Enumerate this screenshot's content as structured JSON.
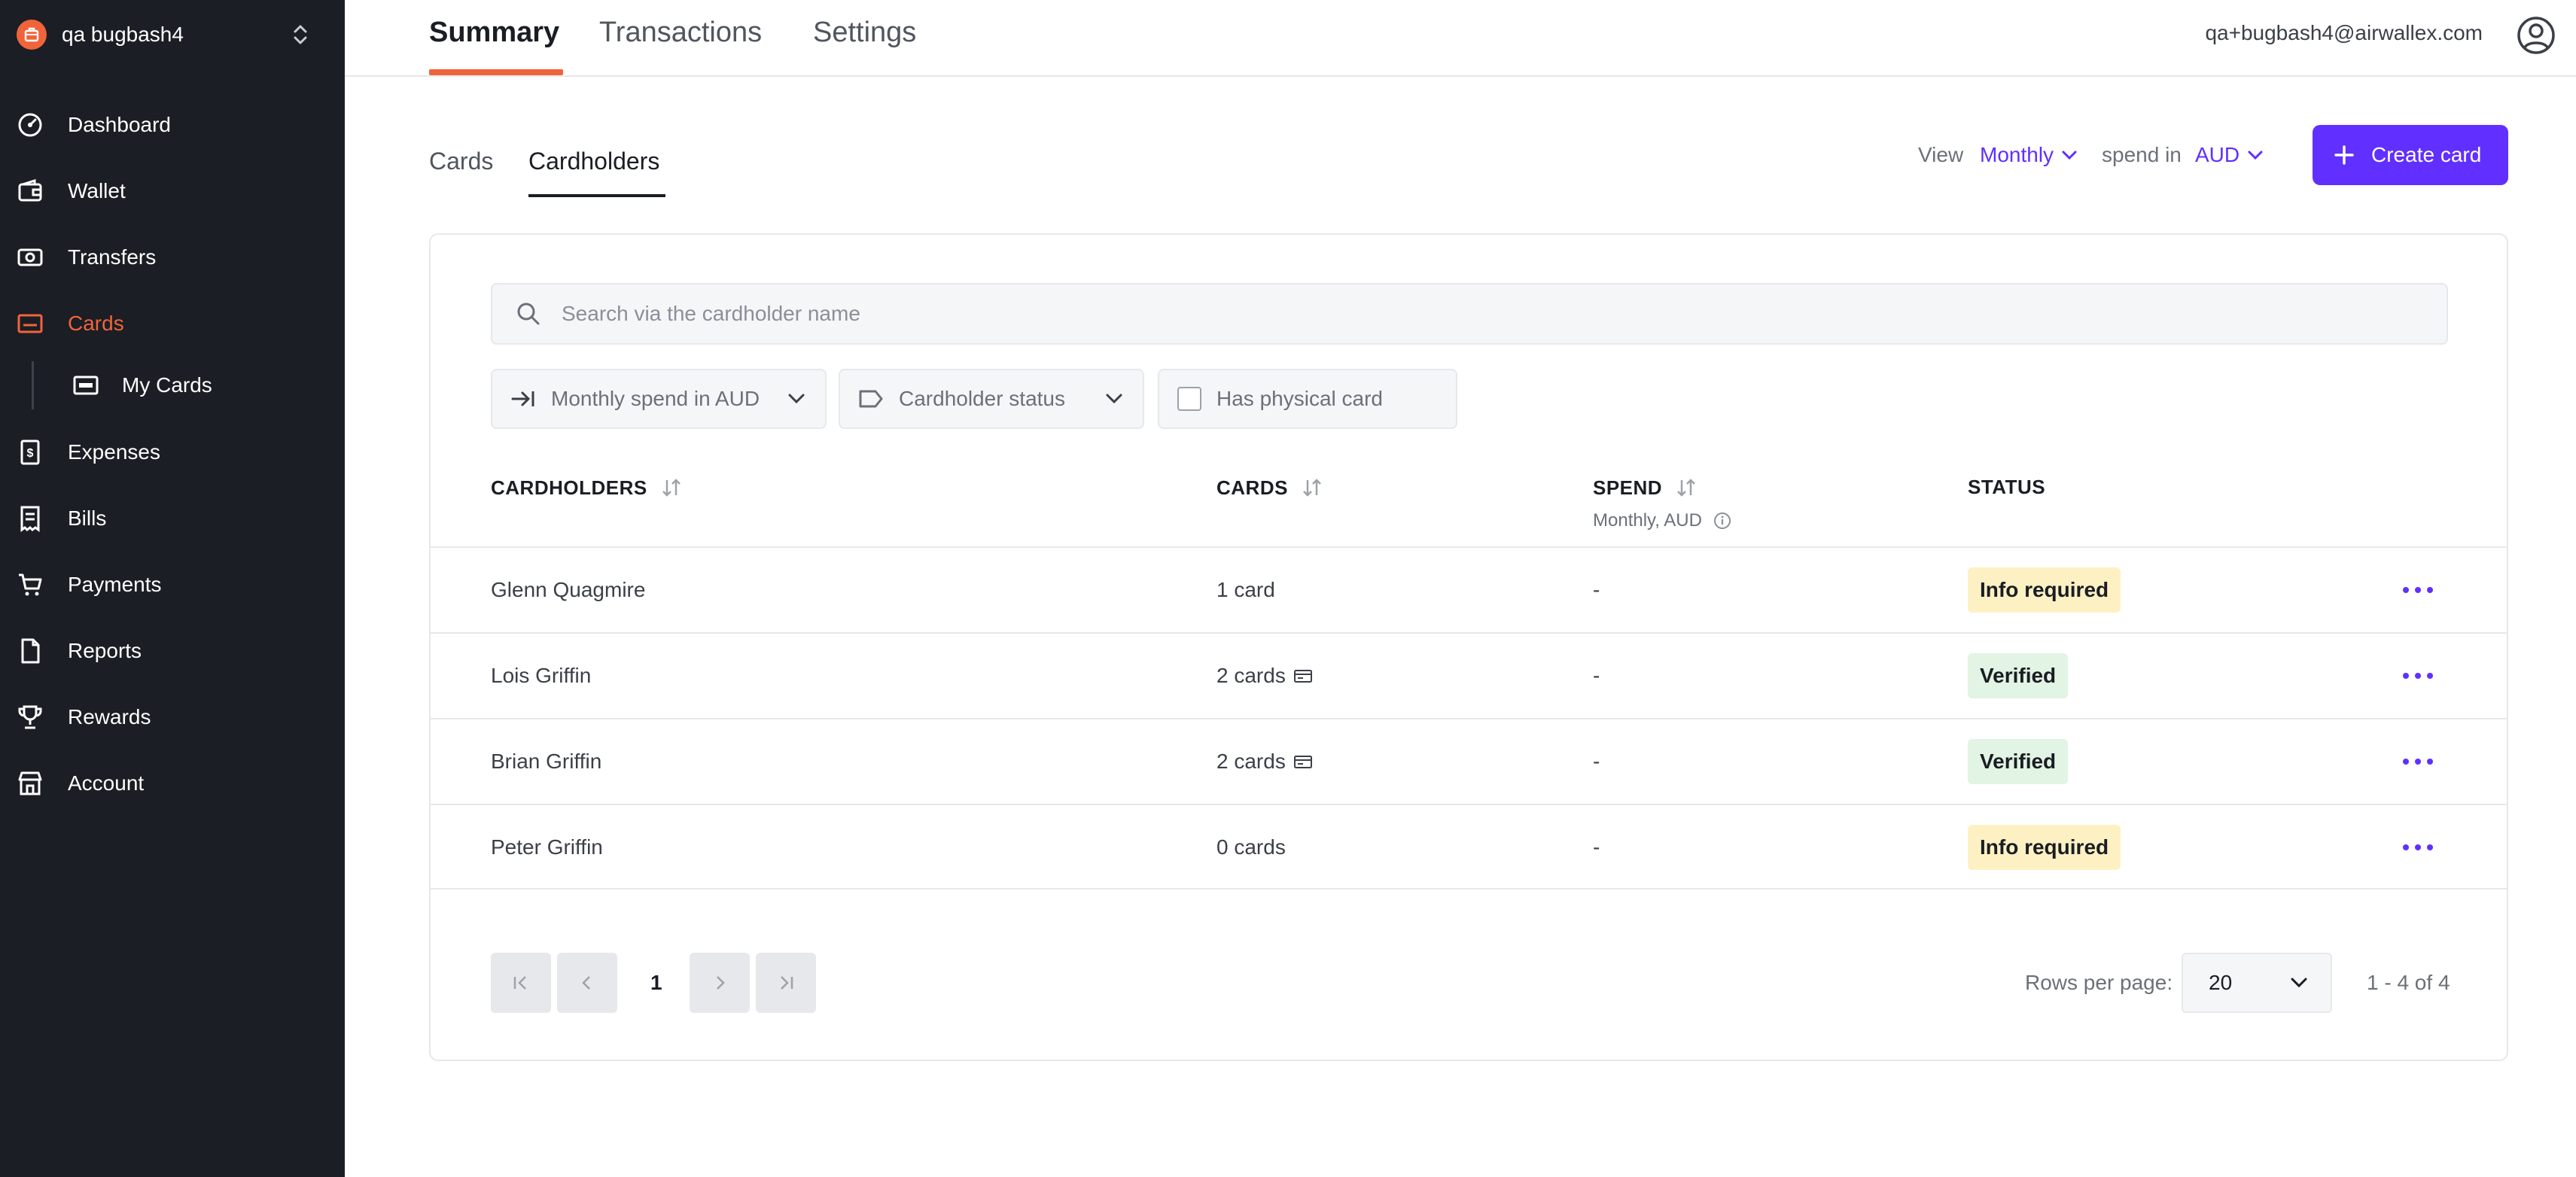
{
  "sidebar": {
    "org_name": "qa bugbash4",
    "items": [
      {
        "label": "Dashboard",
        "icon": "dashboard-icon"
      },
      {
        "label": "Wallet",
        "icon": "wallet-icon"
      },
      {
        "label": "Transfers",
        "icon": "transfers-icon"
      },
      {
        "label": "Cards",
        "icon": "card-icon",
        "active": true
      },
      {
        "label": "My Cards",
        "icon": "card-icon",
        "sub": true
      },
      {
        "label": "Expenses",
        "icon": "expenses-icon"
      },
      {
        "label": "Bills",
        "icon": "bills-icon"
      },
      {
        "label": "Payments",
        "icon": "cart-icon"
      },
      {
        "label": "Reports",
        "icon": "document-icon"
      },
      {
        "label": "Rewards",
        "icon": "trophy-icon"
      },
      {
        "label": "Account",
        "icon": "store-icon"
      }
    ]
  },
  "header": {
    "tabs": [
      {
        "label": "Summary",
        "active": true
      },
      {
        "label": "Transactions"
      },
      {
        "label": "Settings"
      }
    ],
    "user_email": "qa+bugbash4@airwallex.com"
  },
  "subtabs": [
    {
      "label": "Cards"
    },
    {
      "label": "Cardholders",
      "active": true
    }
  ],
  "view_controls": {
    "view_label": "View",
    "period": "Monthly",
    "spend_label": "spend in",
    "currency": "AUD",
    "create_button": "Create card"
  },
  "search": {
    "placeholder": "Search via the cardholder name",
    "value": ""
  },
  "filters": {
    "spend": "Monthly spend in AUD",
    "status": "Cardholder status",
    "physical": "Has physical card"
  },
  "table": {
    "columns": {
      "cardholders": "CARDHOLDERS",
      "cards": "CARDS",
      "spend": "SPEND",
      "spend_sub": "Monthly, AUD",
      "status": "STATUS"
    },
    "rows": [
      {
        "name": "Glenn Quagmire",
        "cards": "1 card",
        "card_icon": false,
        "spend": "-",
        "status": "Info required",
        "status_type": "warn"
      },
      {
        "name": "Lois Griffin",
        "cards": "2 cards",
        "card_icon": true,
        "spend": "-",
        "status": "Verified",
        "status_type": "ok"
      },
      {
        "name": "Brian Griffin",
        "cards": "2 cards",
        "card_icon": true,
        "spend": "-",
        "status": "Verified",
        "status_type": "ok"
      },
      {
        "name": "Peter Griffin",
        "cards": "0 cards",
        "card_icon": false,
        "spend": "-",
        "status": "Info required",
        "status_type": "warn"
      }
    ]
  },
  "pagination": {
    "current_page": "1",
    "rows_per_page_label": "Rows per page:",
    "rows_per_page": "20",
    "range": "1 - 4 of 4"
  },
  "colors": {
    "brand_orange": "#f0643b",
    "accent_purple": "#612fff",
    "sidebar_bg": "#1b1e24",
    "badge_warn": "#fdf1c4",
    "badge_ok": "#e2f4e4"
  }
}
